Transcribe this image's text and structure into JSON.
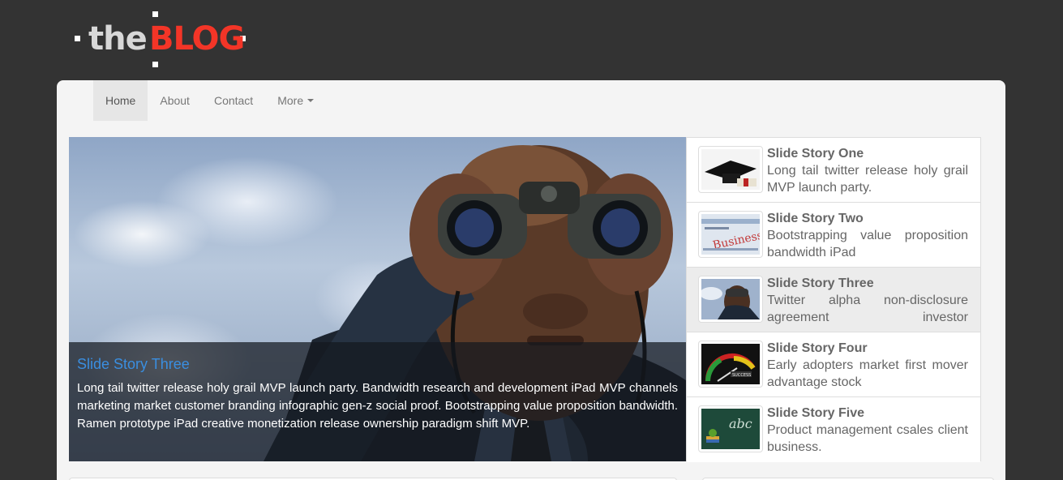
{
  "logo": {
    "the": "the",
    "blog": "BLOG"
  },
  "nav": {
    "items": [
      {
        "label": "Home",
        "active": true
      },
      {
        "label": "About"
      },
      {
        "label": "Contact"
      },
      {
        "label": "More",
        "dropdown": true
      }
    ]
  },
  "slider": {
    "caption_title": "Slide Story Three",
    "caption_text": "Long tail twitter release holy grail MVP launch party. Bandwidth research and development iPad MVP channels marketing market customer branding infographic gen-z social proof. Bootstrapping value proposition bandwidth. Ramen prototype iPad creative monetization release ownership paradigm shift MVP."
  },
  "stories": [
    {
      "title": "Slide Story One",
      "text": "Long tail twitter release holy grail MVP launch party.",
      "thumb": "graduation-cap-thumb"
    },
    {
      "title": "Slide Story Two",
      "text": "Bootstrapping value proposition bandwidth iPad",
      "thumb": "business-newspaper-thumb"
    },
    {
      "title": "Slide Story Three",
      "text": "Twitter alpha non-disclosure agreement investor",
      "thumb": "binoculars-man-thumb",
      "active": true
    },
    {
      "title": "Slide Story Four",
      "text": "Early adopters market first mover advantage stock",
      "thumb": "success-gauge-thumb"
    },
    {
      "title": "Slide Story Five",
      "text": "Product management csales client business.",
      "thumb": "chalkboard-abc-thumb"
    }
  ],
  "colors": {
    "background": "#333333",
    "logo_accent": "#f33527",
    "caption_title": "#3a8ee0",
    "panel": "#f4f4f4"
  }
}
